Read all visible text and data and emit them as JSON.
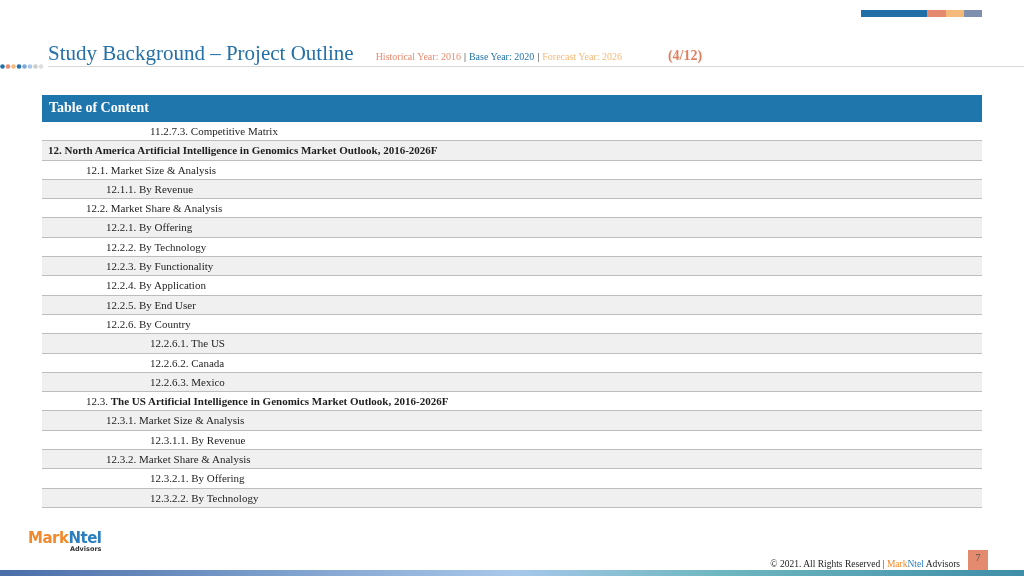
{
  "header": {
    "title": "Study Background – Project Outline",
    "years": [
      {
        "kind": "historical",
        "text": "Historical Year: 2016"
      },
      {
        "kind": "base",
        "text": "Base Year: 2020"
      },
      {
        "kind": "forecast",
        "text": "Forecast Year: 2026"
      }
    ],
    "separator": "|",
    "page_of": "(4/12)"
  },
  "toc": {
    "title": "Table of Content",
    "items": [
      {
        "kind": "continuation",
        "text": "11.2.7.3.  Competitive Matrix"
      },
      {
        "kind": "chapter",
        "text": "12.  North America Artificial Intelligence in Genomics Market Outlook, 2016-2026F",
        "children": [
          {
            "text": "12.1.  Market Size & Analysis",
            "children": [
              {
                "text": "12.1.1.  By Revenue"
              }
            ]
          },
          {
            "text": "12.2.  Market Share & Analysis",
            "children": [
              {
                "text": "12.2.1.  By Offering"
              },
              {
                "text": "12.2.2.  By Technology"
              },
              {
                "text": "12.2.3.  By Functionality"
              },
              {
                "text": "12.2.4.  By Application"
              },
              {
                "text": "12.2.5.  By End User"
              },
              {
                "text": "12.2.6.  By Country",
                "children": [
                  {
                    "text": "12.2.6.1.  The US"
                  },
                  {
                    "text": "12.2.6.2.  Canada"
                  },
                  {
                    "text": "12.2.6.3.  Mexico"
                  }
                ]
              }
            ]
          },
          {
            "text": "12.3.  **The US Artificial Intelligence in Genomics Market Outlook, 2016-2026F**",
            "children": [
              {
                "text": "12.3.1.  Market Size & Analysis",
                "children": [
                  {
                    "text": "12.3.1.1. By Revenue"
                  }
                ]
              },
              {
                "text": "12.3.2.  Market Share & Analysis",
                "children": [
                  {
                    "text": "12.3.2.1. By Offering"
                  },
                  {
                    "text": "12.3.2.2. By Technology"
                  }
                ]
              }
            ]
          }
        ]
      }
    ]
  },
  "footer": {
    "logo_main": "Mark",
    "logo_accent": "Ntel",
    "logo_sub": "Advisors",
    "copyright": "© 2021. All Rights Reserved |",
    "brand_a": "Mark",
    "brand_b": "Ntel",
    "brand_c": "Advisors",
    "page": "7"
  }
}
